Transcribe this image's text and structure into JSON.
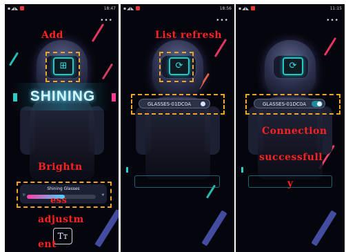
{
  "colors": {
    "accent": "#22c6c6",
    "annotation": "#ff2222",
    "highlight": "#f3a52a"
  },
  "panels": [
    {
      "status_time": "18:47",
      "menu_icon": "more-dots-icon",
      "center_icon": "scan-add-icon",
      "center_glyph": "⊞",
      "annotation_top": "Add",
      "logo_text": "SHINING",
      "annotation_mid_1": "Brightn",
      "annotation_mid_2": "ess",
      "annotation_bottom_1": "adjustm",
      "annotation_bottom_2": "ent",
      "brightness": {
        "title": "Shining Glasses",
        "level": 0.55
      },
      "text_button": "Tт"
    },
    {
      "status_time": "18:56",
      "menu_icon": "more-dots-icon",
      "center_icon": "refresh-icon",
      "center_glyph": "⟳",
      "annotation_top": "List refresh",
      "device_name": "GLASSES-01DC0A"
    },
    {
      "status_time": "11:15",
      "menu_icon": "more-dots-icon",
      "center_icon": "refresh-icon",
      "center_glyph": "⟳",
      "device_name": "GLASSES-01DC0A",
      "annotation_1": "Connection",
      "annotation_2": "successfull",
      "annotation_3": "y"
    }
  ],
  "status_icons": "▪◢◣ ▶"
}
